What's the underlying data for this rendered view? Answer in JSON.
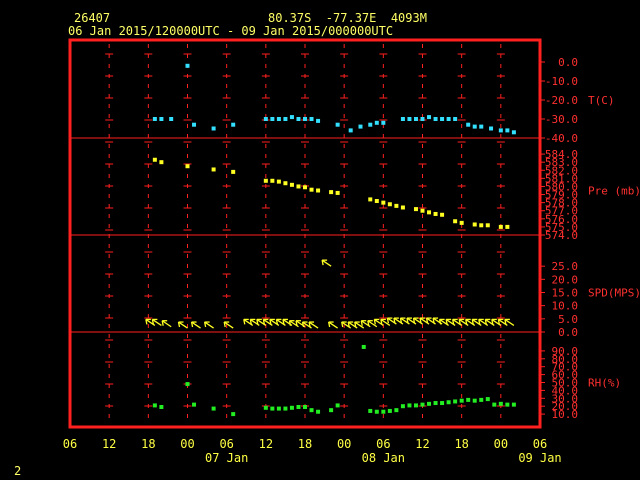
{
  "header": {
    "station": "26407",
    "position": "80.37S  -77.37E  4093M",
    "period": "06 Jan 2015/120000UTC - 09 Jan 2015/000000UTC"
  },
  "corner_label": "2",
  "colors": {
    "frame": "#ff2020",
    "text": "#ffff44",
    "axis_text": "#ff3030",
    "temperature": "#33e0ff",
    "pressure": "#ffff22",
    "wind": "#ffff22",
    "humidity": "#22ee22"
  },
  "chart_data": {
    "type": "scatter",
    "x_axis": {
      "unit": "hours since 06 Jan 2015 00 UTC",
      "range": [
        0,
        72
      ],
      "tick_hours": [
        0,
        6,
        12,
        18,
        24,
        30,
        36,
        42,
        48,
        54,
        60,
        66,
        72
      ],
      "tick_labels": [
        "06",
        "12",
        "18",
        "00",
        "06",
        "12",
        "18",
        "00",
        "06",
        "12",
        "18",
        "00",
        "06"
      ],
      "date_labels": [
        {
          "hour": 24,
          "label": "07 Jan"
        },
        {
          "hour": 48,
          "label": "08 Jan"
        },
        {
          "hour": 72,
          "label": "09 Jan"
        }
      ]
    },
    "panels": [
      {
        "id": "temperature",
        "label": "T(C)",
        "ylim": [
          -40,
          0
        ],
        "ticks": [
          0,
          -10,
          -20,
          -30,
          -40
        ],
        "tick_labels": [
          "0.0",
          "-10.0",
          "-20.0",
          "-30.0",
          "-40.0"
        ],
        "points": [
          [
            13,
            -30
          ],
          [
            14,
            -30
          ],
          [
            15.5,
            -30
          ],
          [
            18,
            -2
          ],
          [
            19,
            -33
          ],
          [
            22,
            -35
          ],
          [
            25,
            -33
          ],
          [
            30,
            -30
          ],
          [
            31,
            -30
          ],
          [
            32,
            -30
          ],
          [
            33,
            -30
          ],
          [
            34,
            -29
          ],
          [
            35,
            -30
          ],
          [
            36,
            -30
          ],
          [
            37,
            -30
          ],
          [
            38,
            -31
          ],
          [
            41,
            -33
          ],
          [
            43,
            -36
          ],
          [
            44.5,
            -34
          ],
          [
            46,
            -33
          ],
          [
            47,
            -32
          ],
          [
            48,
            -32
          ],
          [
            51,
            -30
          ],
          [
            52,
            -30
          ],
          [
            53,
            -30
          ],
          [
            54,
            -30
          ],
          [
            55,
            -29
          ],
          [
            56,
            -30
          ],
          [
            57,
            -30
          ],
          [
            58,
            -30
          ],
          [
            59,
            -30
          ],
          [
            61,
            -33
          ],
          [
            62,
            -34
          ],
          [
            63,
            -34
          ],
          [
            64.5,
            -35
          ],
          [
            66,
            -36
          ],
          [
            67,
            -36
          ],
          [
            68,
            -37
          ]
        ]
      },
      {
        "id": "pressure",
        "label": "Pre (mb)",
        "ylim": [
          574,
          585
        ],
        "ticks": [
          584,
          583,
          582,
          581,
          580,
          579,
          578,
          577,
          576,
          575,
          574
        ],
        "tick_labels": [
          "584.0",
          "583.0",
          "582.0",
          "581.0",
          "580.0",
          "579.0",
          "578.0",
          "577.0",
          "576.0",
          "575.0",
          "574.0"
        ],
        "points": [
          [
            13,
            583.3
          ],
          [
            14,
            583.0
          ],
          [
            18,
            582.5
          ],
          [
            22,
            582.1
          ],
          [
            25,
            581.8
          ],
          [
            30,
            580.7
          ],
          [
            31,
            580.7
          ],
          [
            32,
            580.6
          ],
          [
            33,
            580.4
          ],
          [
            34,
            580.2
          ],
          [
            35,
            580.0
          ],
          [
            36,
            579.9
          ],
          [
            37,
            579.6
          ],
          [
            38,
            579.5
          ],
          [
            40,
            579.3
          ],
          [
            41,
            579.2
          ],
          [
            46,
            578.4
          ],
          [
            47,
            578.2
          ],
          [
            48,
            578.0
          ],
          [
            49,
            577.8
          ],
          [
            50,
            577.6
          ],
          [
            51,
            577.4
          ],
          [
            53,
            577.2
          ],
          [
            54,
            577.0
          ],
          [
            55,
            576.8
          ],
          [
            56,
            576.6
          ],
          [
            57,
            576.5
          ],
          [
            59,
            575.7
          ],
          [
            60,
            575.5
          ],
          [
            62,
            575.3
          ],
          [
            63,
            575.2
          ],
          [
            64,
            575.2
          ],
          [
            66,
            575.0
          ],
          [
            67,
            575.0
          ]
        ]
      },
      {
        "id": "wind",
        "label": "SPD(MPS)",
        "ylim": [
          0,
          30
        ],
        "ticks": [
          25,
          20,
          15,
          10,
          5,
          0
        ],
        "tick_labels": [
          "25.0",
          "20.0",
          "15.0",
          "10.0",
          "5.0",
          "0.0"
        ],
        "vectors": [
          [
            13,
            2.5
          ],
          [
            14,
            2.5
          ],
          [
            15.5,
            2.0
          ],
          [
            18,
            1.5
          ],
          [
            20,
            1.5
          ],
          [
            22,
            1.5
          ],
          [
            25,
            1.5
          ],
          [
            28,
            2.5
          ],
          [
            29,
            2.5
          ],
          [
            30,
            2.5
          ],
          [
            31,
            2.5
          ],
          [
            32,
            2.5
          ],
          [
            33,
            2.5
          ],
          [
            34,
            2.5
          ],
          [
            35,
            2.0
          ],
          [
            36,
            2.0
          ],
          [
            37,
            1.5
          ],
          [
            38,
            1.5
          ],
          [
            40,
            25.0
          ],
          [
            41,
            1.5
          ],
          [
            43,
            1.5
          ],
          [
            44,
            1.5
          ],
          [
            45,
            1.5
          ],
          [
            46,
            2.0
          ],
          [
            47,
            2.0
          ],
          [
            48,
            2.5
          ],
          [
            49,
            2.5
          ],
          [
            50,
            3.0
          ],
          [
            51,
            3.0
          ],
          [
            52,
            3.0
          ],
          [
            53,
            3.0
          ],
          [
            54,
            3.0
          ],
          [
            55,
            3.0
          ],
          [
            56,
            3.0
          ],
          [
            57,
            3.0
          ],
          [
            58,
            2.5
          ],
          [
            59,
            2.5
          ],
          [
            60,
            2.5
          ],
          [
            61,
            2.5
          ],
          [
            62,
            2.5
          ],
          [
            63,
            2.5
          ],
          [
            64,
            2.5
          ],
          [
            65,
            2.5
          ],
          [
            66,
            2.5
          ],
          [
            67,
            2.5
          ],
          [
            68,
            2.5
          ]
        ]
      },
      {
        "id": "humidity",
        "label": "RH(%)",
        "ylim": [
          0,
          100
        ],
        "ticks": [
          90,
          80,
          70,
          60,
          50,
          40,
          30,
          20,
          10
        ],
        "tick_labels": [
          "90.0",
          "80.0",
          "70.0",
          "60.0",
          "50.0",
          "40.0",
          "30.0",
          "20.0",
          "10.0"
        ],
        "points": [
          [
            13,
            21
          ],
          [
            14,
            19
          ],
          [
            18,
            48
          ],
          [
            19,
            22
          ],
          [
            22,
            17
          ],
          [
            25,
            10
          ],
          [
            30,
            18
          ],
          [
            31,
            17
          ],
          [
            32,
            17
          ],
          [
            33,
            17
          ],
          [
            34,
            18
          ],
          [
            35,
            19
          ],
          [
            36,
            19
          ],
          [
            37,
            15
          ],
          [
            38,
            13
          ],
          [
            40,
            15
          ],
          [
            41,
            21
          ],
          [
            45,
            95
          ],
          [
            46,
            14
          ],
          [
            47,
            13
          ],
          [
            48,
            13
          ],
          [
            49,
            14
          ],
          [
            50,
            15
          ],
          [
            51,
            20
          ],
          [
            52,
            21
          ],
          [
            53,
            21
          ],
          [
            54,
            22
          ],
          [
            55,
            23
          ],
          [
            56,
            24
          ],
          [
            57,
            24
          ],
          [
            58,
            25
          ],
          [
            59,
            26
          ],
          [
            60,
            27
          ],
          [
            61,
            28
          ],
          [
            62,
            27
          ],
          [
            63,
            28
          ],
          [
            64,
            29
          ],
          [
            65,
            22
          ],
          [
            66,
            23
          ],
          [
            67,
            22
          ],
          [
            68,
            22
          ]
        ]
      }
    ]
  }
}
